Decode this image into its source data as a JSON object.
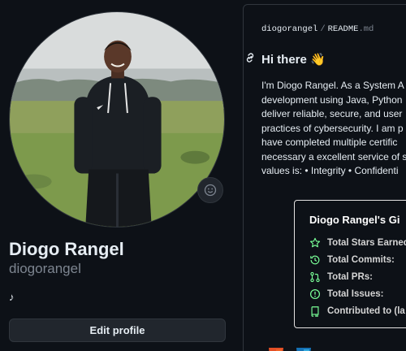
{
  "profile": {
    "name": "Diogo Rangel",
    "login": "diogorangel",
    "status_emoji": "♪",
    "edit_label": "Edit profile"
  },
  "readme": {
    "owner": "diogorangel",
    "separator": "/",
    "file_base": "README",
    "file_ext": ".md",
    "heading": "Hi there 👋",
    "bio_lines": [
      "I'm Diogo Rangel. As a System A",
      "development using Java, Python",
      "deliver reliable, secure, and user",
      "practices of cybersecurity. I am p",
      "have completed multiple certific",
      "necessary a excellent service of s",
      "values is: • Integrity • Confidenti"
    ]
  },
  "stats_card": {
    "title": "Diogo Rangel's Gi",
    "rows": [
      {
        "label": "Total Stars Earned:",
        "icon": "star-icon"
      },
      {
        "label": "Total Commits:",
        "icon": "history-icon"
      },
      {
        "label": "Total PRs:",
        "icon": "pull-request-icon"
      },
      {
        "label": "Total Issues:",
        "icon": "issue-icon"
      },
      {
        "label": "Contributed to (la",
        "icon": "repo-icon"
      }
    ]
  },
  "colors": {
    "background": "#0d1117",
    "border": "#30363d",
    "muted": "#7d8590",
    "stats_icon": "#79ff97"
  }
}
